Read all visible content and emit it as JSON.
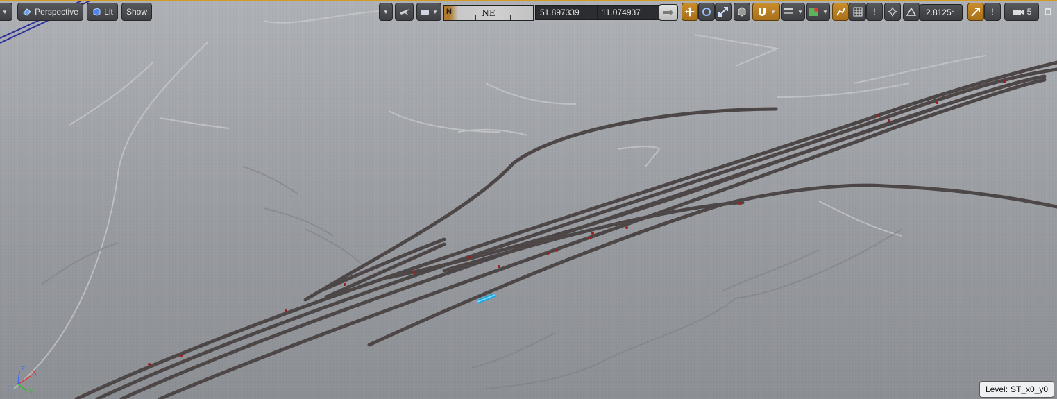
{
  "toolbar": {
    "view_mode_label": "Perspective",
    "lighting_label": "Lit",
    "show_label": "Show",
    "compass_north": "N",
    "compass_heading": "NE",
    "latitude": "51.897339",
    "longitude": "11.074937",
    "rotation_snap_value": "2.8125°",
    "camera_speed_value": "5"
  },
  "viewport": {
    "level_prefix": "Level:",
    "level_name": "ST_x0_y0",
    "axis_labels": {
      "x": "X",
      "y": "Y",
      "z": "Z"
    }
  },
  "colors": {
    "accent": "#d39b22",
    "track": "#4d4647",
    "selected_actor": "#1fa8e0",
    "signal_marker": "#9a1f1f"
  },
  "icons": [
    "perspective-cube-icon",
    "lit-sphere-icon",
    "transform-move-icon",
    "transform-rotate-icon",
    "transform-scale-icon",
    "world-local-icon",
    "surface-snap-icon",
    "camera-icon",
    "map-icon",
    "grid-snap-icon",
    "rotation-snap-icon",
    "scale-snap-icon",
    "camera-speed-icon",
    "maximize-icon"
  ]
}
